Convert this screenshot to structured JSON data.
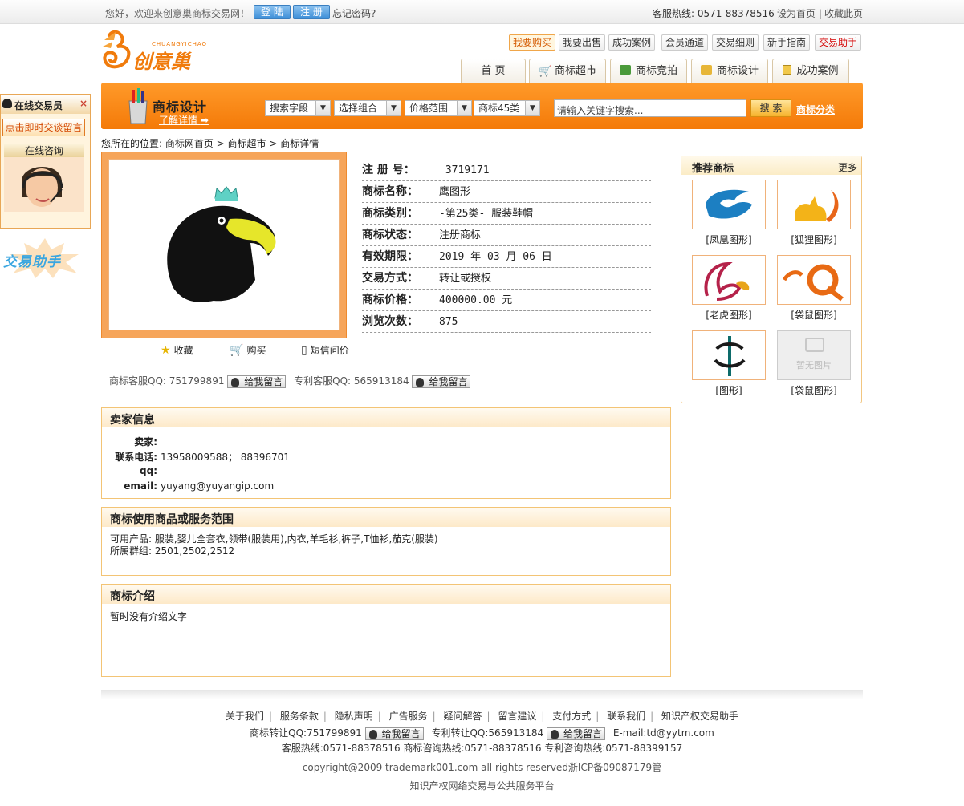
{
  "topbar": {
    "welcome": "您好，欢迎来创意巢商标交易网！",
    "login": "登 陆",
    "register": "注 册",
    "forgot": "忘记密码?",
    "hotline": "客服热线: 0571-88378516",
    "set_home": "设为首页 |",
    "favorite": "收藏此页"
  },
  "logo": {
    "text": "创意巢",
    "sub": "CHUANGYICHAO"
  },
  "small_nav": [
    "我要购买",
    "我要出售",
    "成功案例",
    "会员通道",
    "交易细则",
    "新手指南",
    "交易助手"
  ],
  "tabs": [
    "首 页",
    "商标超市",
    "商标竞拍",
    "商标设计",
    "成功案例"
  ],
  "banner": {
    "title": "商标设计",
    "more": "了解详情",
    "selects": [
      "搜索字段",
      "选择组合",
      "价格范围",
      "商标45类"
    ],
    "search_placeholder": "请输入关键字搜索...",
    "search_button": "搜 索",
    "category_link": "商标分类"
  },
  "breadcrumb": "您所在的位置: 商标网首页 > 商标超市 > 商标详情",
  "detail": {
    "rows": [
      {
        "label": "注 册 号：",
        "value": " 3719171"
      },
      {
        "label": "商标名称：",
        "value": "鹰图形"
      },
      {
        "label": "商标类别：",
        "value": "-第25类- 服装鞋帽"
      },
      {
        "label": "商标状态：",
        "value": "注册商标"
      },
      {
        "label": "有效期限：",
        "value": "2019 年 03 月 06 日"
      },
      {
        "label": "交易方式：",
        "value": "转让或授权"
      },
      {
        "label": "商标价格：",
        "value": "400000.00 元"
      },
      {
        "label": "浏览次数：",
        "value": "875"
      }
    ],
    "actions": [
      "收藏",
      "购买",
      "短信问价"
    ],
    "qq1_label": "商标客服QQ: 751799891",
    "qq2_label": "专利客服QQ: 565913184",
    "msg_button": "给我留言"
  },
  "recommend": {
    "title": "推荐商标",
    "more": "更多",
    "items": [
      "[凤凰图形]",
      "[狐狸图形]",
      "[老虎图形]",
      "[袋鼠图形]",
      "[图形]",
      "[袋鼠图形]"
    ],
    "no_image": "暂无图片"
  },
  "seller": {
    "title": "卖家信息",
    "seller_label": "卖家:",
    "seller_value": "",
    "phone_label": "联系电话:",
    "phone_value": "13958009588； 88396701",
    "qq_label": "qq:",
    "qq_value": "",
    "email_label": "email:",
    "email_value": "yuyang@yuyangip.com"
  },
  "scope": {
    "title": "商标使用商品或服务范围",
    "products": "可用产品: 服装,婴儿全套衣,领带(服装用),内衣,羊毛衫,裤子,T恤衫,茄克(服装)",
    "groups": "所属群组: 2501,2502,2512"
  },
  "intro": {
    "title": "商标介绍",
    "text": "暂时没有介绍文字"
  },
  "footer": {
    "links": [
      "关于我们",
      "服务条款",
      "隐私声明",
      "广告服务",
      "疑问解答",
      "留言建议",
      "支付方式",
      "联系我们",
      "知识产权交易助手"
    ],
    "qq_trans": "商标转让QQ:751799891",
    "qq_patent": "专利转让QQ:565913184",
    "email": "E-mail:td@yytm.com",
    "hotlines": "客服热线:0571-88378516 商标咨询热线:0571-88378516 专利咨询热线:0571-88399157",
    "copyright": "copyright@2009 trademark001.com all rights reserved浙ICP备09087179管",
    "platform": "知识产权网络交易与公共服务平台"
  },
  "float_panel": {
    "title": "在线交易员",
    "close": "×",
    "chat": "点击即时交谈留言",
    "consult": "在线咨询",
    "assistant": "交易助手"
  },
  "colors": {
    "accent": "#f47a08",
    "border": "#f3c475",
    "link_blue": "#3d8fd8"
  }
}
